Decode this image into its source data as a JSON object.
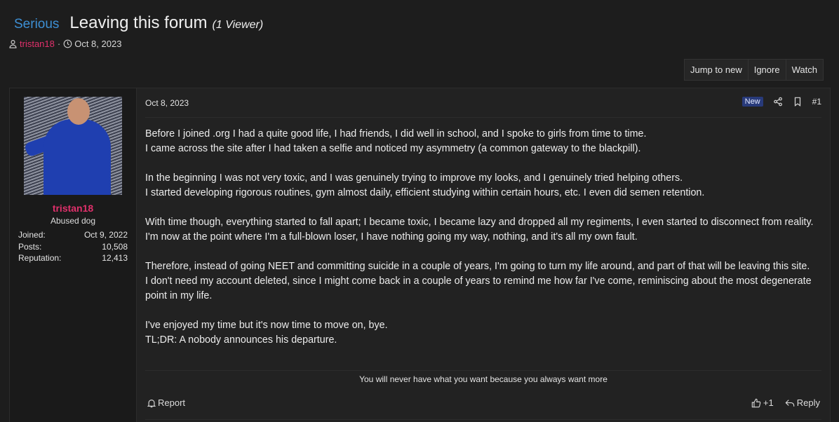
{
  "thread": {
    "prefix": "Serious",
    "title": "Leaving this forum",
    "viewers": "(1 Viewer)",
    "author": "tristan18",
    "separator": "·",
    "date": "Oct 8, 2023"
  },
  "thread_actions": {
    "jump_label": "Jump to new",
    "ignore_label": "Ignore",
    "watch_label": "Watch"
  },
  "user": {
    "name": "tristan18",
    "title": "Abused dog",
    "stats": [
      {
        "label": "Joined:",
        "value": "Oct 9, 2022"
      },
      {
        "label": "Posts:",
        "value": "10,508"
      },
      {
        "label": "Reputation:",
        "value": "12,413"
      }
    ],
    "avatar_icon": "avatar-image"
  },
  "post": {
    "date": "Oct 8, 2023",
    "new_badge": "New",
    "number": "#1",
    "paragraphs": [
      [
        "Before I joined .org I had a quite good life, I had friends, I did well in school, and I spoke to girls from time to time.",
        "I came across the site after I had taken a selfie and noticed my asymmetry (a common gateway to the blackpill)."
      ],
      [
        "In the beginning I was not very toxic, and I was genuinely trying to improve my looks, and I genuinely tried helping others.",
        "I started developing rigorous routines, gym almost daily, efficient studying within certain hours, etc. I even did semen retention."
      ],
      [
        "With time though, everything started to fall apart; I became toxic, I became lazy and dropped all my regiments, I even started to disconnect from reality.",
        "I'm now at the point where I'm a full-blown loser, I have nothing going my way, nothing, and it's all my own fault."
      ],
      [
        "Therefore, instead of going NEET and committing suicide in a couple of years, I'm going to turn my life around, and part of that will be leaving this site.",
        "I don't need my account deleted, since I might come back in a couple of years to remind me how far I've come, reminiscing about the most degenerate point in my life."
      ],
      [
        "I've enjoyed my time but it's now time to move on, bye.",
        "TL;DR: A nobody announces his departure."
      ]
    ],
    "signature": "You will never have what you want because you always want more",
    "report_label": "Report",
    "reaction_count": "+1",
    "reply_label": "Reply"
  },
  "colors": {
    "accent_prefix": "#3d8fd4",
    "username": "#e0306b",
    "badge": "#283a7a"
  }
}
